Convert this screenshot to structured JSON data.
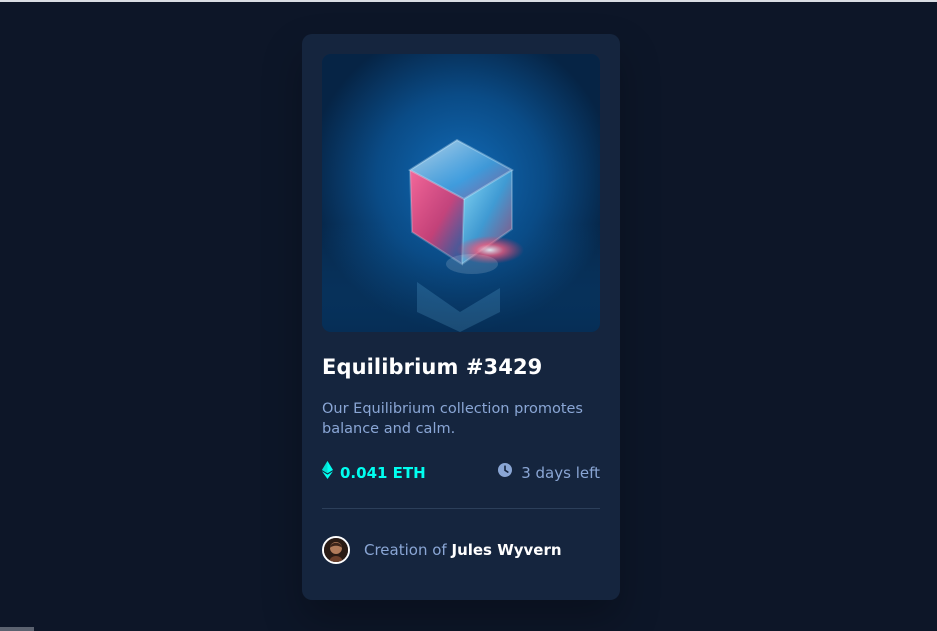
{
  "page": {
    "background": "#0d1628"
  },
  "card": {
    "background": "#15253e",
    "title": "Equilibrium #3429",
    "description": "Our Equilibrium collection promotes balance and calm.",
    "price": "0.041 ETH",
    "time_left": "3 days left",
    "creator_prefix": "Creation of",
    "creator_name": "Jules Wyvern"
  },
  "icons": {
    "ethereum": "ethereum-icon",
    "clock": "clock-icon",
    "avatar": "avatar-image"
  },
  "colors": {
    "accent": "#00fff0",
    "muted_text": "#8aa6d5",
    "white": "#ffffff",
    "divider": "#2c3f5a"
  }
}
